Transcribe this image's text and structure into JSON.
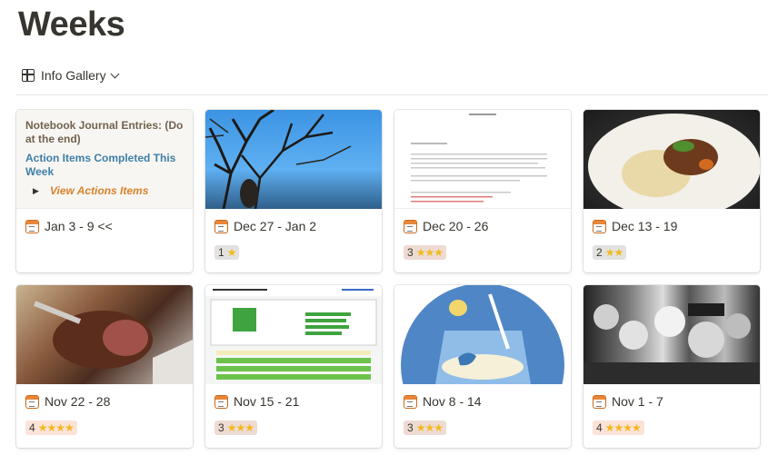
{
  "page": {
    "title": "Weeks"
  },
  "view": {
    "label": "Info Gallery"
  },
  "notes": {
    "line1": "Notebook Journal Entries: (Do at the end)",
    "line2": "Action Items Completed This Week",
    "line3": "View Actions Items"
  },
  "cards": [
    {
      "title": "Jan 3 - 9 <<",
      "rating": "",
      "stars": ""
    },
    {
      "title": "Dec 27 - Jan 2",
      "rating": "1",
      "stars": "★"
    },
    {
      "title": "Dec 20 - 26",
      "rating": "3",
      "stars": "★★★"
    },
    {
      "title": "Dec 13 - 19",
      "rating": "2",
      "stars": "★★"
    },
    {
      "title": "Nov 22 - 28",
      "rating": "4",
      "stars": "★★★★"
    },
    {
      "title": "Nov 15 - 21",
      "rating": "3",
      "stars": "★★★"
    },
    {
      "title": "Nov 8 - 14",
      "rating": "3",
      "stars": "★★★"
    },
    {
      "title": "Nov 1 - 7",
      "rating": "4",
      "stars": "★★★★"
    }
  ],
  "colors": {
    "text": "#37352f",
    "link_blue": "#3f7fa7",
    "orange": "#d9822b",
    "star": "#f2b91c"
  }
}
